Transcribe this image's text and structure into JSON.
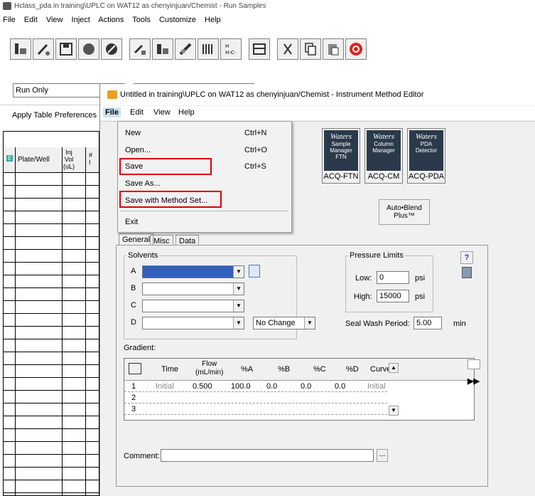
{
  "main_window": {
    "title": "Hclass_pda in training\\UPLC on WAT12 as chenyinjuan/Chemist - Run Samples",
    "menu": [
      "File",
      "Edit",
      "View",
      "Inject",
      "Actions",
      "Tools",
      "Customize",
      "Help"
    ],
    "run_mode": "Run Only",
    "apply_table_pref": "Apply Table Preferences",
    "table_headers": {
      "flag": "E",
      "plate_well": "Plate/Well",
      "inj_vol": "Inj\nVol\n(uL)",
      "num": "#\nI"
    }
  },
  "editor": {
    "title": "Untitled in training\\UPLC on WAT12 as chenyinjuan/Chemist - Instrument Method Editor",
    "menu": [
      "File",
      "Edit",
      "View",
      "Help"
    ],
    "file_menu": [
      {
        "label": "New",
        "shortcut": "Ctrl+N"
      },
      {
        "label": "Open...",
        "shortcut": "Ctrl+O"
      },
      {
        "label": "Save",
        "shortcut": "Ctrl+S",
        "highlight": true
      },
      {
        "label": "Save As...",
        "shortcut": ""
      },
      {
        "label": "Save with Method Set...",
        "shortcut": "",
        "highlight": true
      },
      {
        "label": "Exit",
        "shortcut": ""
      }
    ],
    "modules": [
      {
        "brand": "Waters",
        "sub": "Sample\nManager\nFTN",
        "label": "ACQ-FTN"
      },
      {
        "brand": "Waters",
        "sub": "Column\nManager",
        "label": "ACQ-CM"
      },
      {
        "brand": "Waters",
        "sub": "PDA\nDetector",
        "label": "ACQ-PDA"
      }
    ],
    "auto_blend": "Auto•Blend\nPlus™",
    "tabs": [
      "General",
      "Misc",
      "Data"
    ],
    "solvents": {
      "group_label": "Solvents",
      "rows": [
        "A",
        "B",
        "C",
        "D"
      ],
      "no_change": "No Change"
    },
    "pressure": {
      "group_label": "Pressure Limits",
      "low_label": "Low:",
      "low_value": "0",
      "high_label": "High:",
      "high_value": "15000",
      "unit": "psi"
    },
    "seal_wash": {
      "label": "Seal Wash Period:",
      "value": "5.00",
      "unit": "min"
    },
    "gradient": {
      "label": "Gradient:",
      "headers": [
        "Time",
        "Flow\n(mL/min)",
        "%A",
        "%B",
        "%C",
        "%D",
        "Curve"
      ],
      "rows": [
        [
          "1",
          "Initial",
          "0.500",
          "100.0",
          "0.0",
          "0.0",
          "0.0",
          "Initial"
        ],
        [
          "2",
          "",
          "",
          "",
          "",
          "",
          "",
          ""
        ],
        [
          "3",
          "",
          "",
          "",
          "",
          "",
          "",
          ""
        ]
      ]
    },
    "comment_label": "Comment:",
    "browse": "..."
  }
}
